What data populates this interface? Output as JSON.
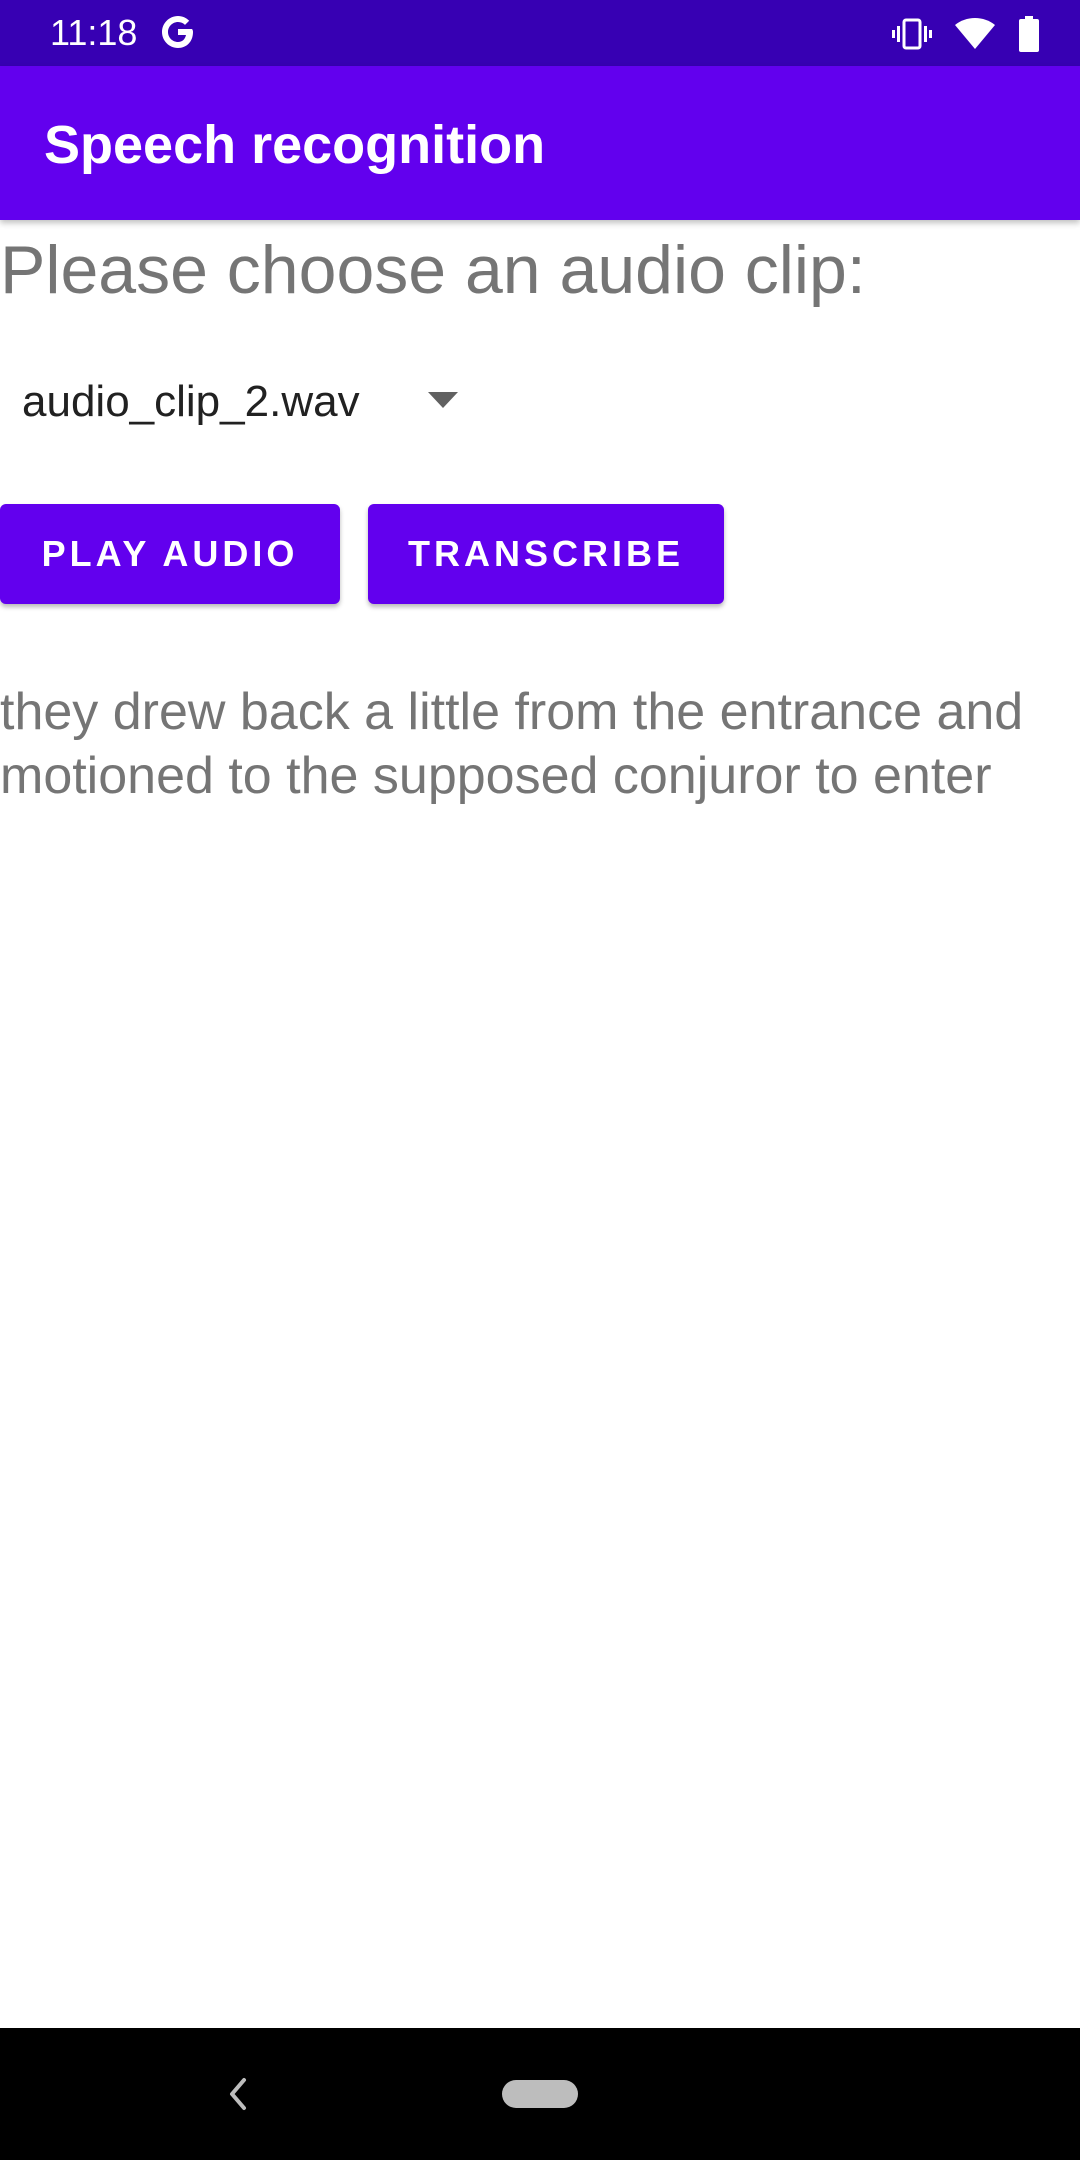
{
  "status_bar": {
    "time": "11:18",
    "icons": [
      "google-g-icon",
      "vibrate-icon",
      "wifi-icon",
      "battery-icon"
    ]
  },
  "app_bar": {
    "title": "Speech recognition"
  },
  "main": {
    "prompt": "Please choose an audio clip:",
    "spinner": {
      "selected": "audio_clip_2.wav",
      "icon": "dropdown-arrow-icon"
    },
    "buttons": {
      "play_label": "PLAY AUDIO",
      "transcribe_label": "TRANSCRIBE"
    },
    "transcript": "they drew back a little from the entrance and motioned to the supposed conjuror to enter"
  },
  "nav_bar": {
    "icons": [
      "back-icon",
      "home-pill-icon"
    ]
  },
  "colors": {
    "status_bar": "#3700b3",
    "primary": "#6200ee",
    "secondary_text": "#757575",
    "primary_text": "#212121"
  }
}
